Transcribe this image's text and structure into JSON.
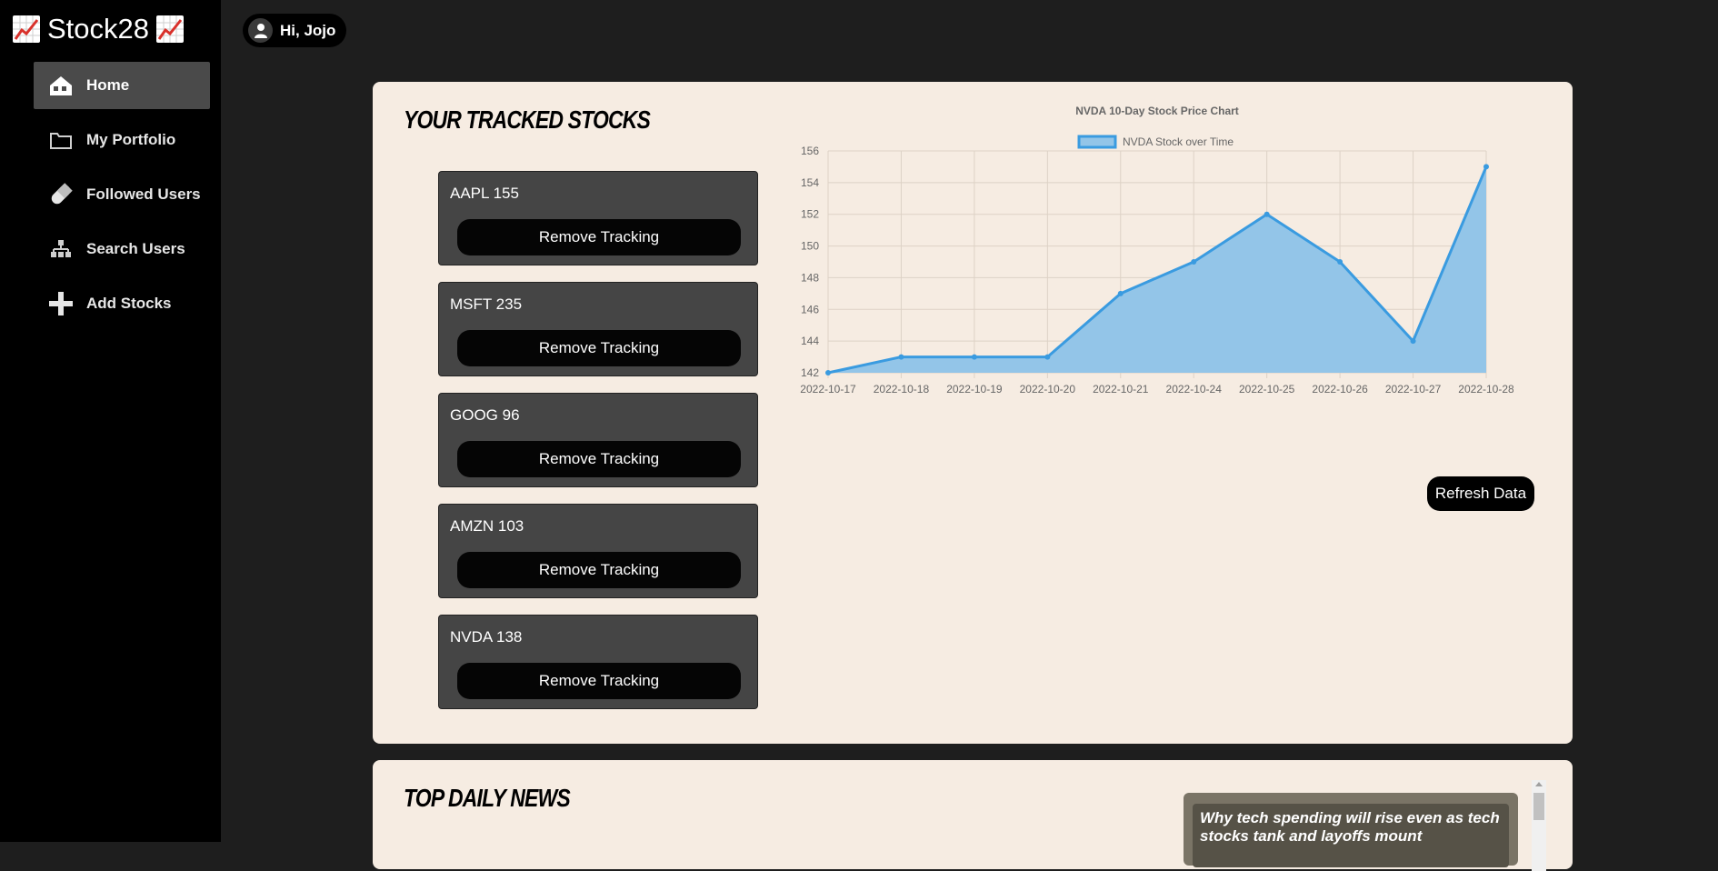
{
  "brand": {
    "name": "Stock28",
    "icon": "chart-increasing-emoji"
  },
  "nav": [
    {
      "label": "Home",
      "icon": "home-icon",
      "active": true
    },
    {
      "label": "My Portfolio",
      "icon": "folder-icon",
      "active": false
    },
    {
      "label": "Followed Users",
      "icon": "pill-icon",
      "active": false
    },
    {
      "label": "Search Users",
      "icon": "network-icon",
      "active": false
    },
    {
      "label": "Add Stocks",
      "icon": "plus-icon",
      "active": false
    }
  ],
  "user": {
    "greeting": "Hi, Jojo",
    "icon": "user-icon"
  },
  "tracked": {
    "title": "Your Tracked Stocks",
    "stocks": [
      {
        "label": "AAPL 155",
        "button": "Remove Tracking"
      },
      {
        "label": "MSFT 235",
        "button": "Remove Tracking"
      },
      {
        "label": "GOOG 96",
        "button": "Remove Tracking"
      },
      {
        "label": "AMZN 103",
        "button": "Remove Tracking"
      },
      {
        "label": "NVDA 138",
        "button": "Remove Tracking"
      }
    ],
    "refresh_label": "Refresh Data"
  },
  "chart_data": {
    "type": "area",
    "title": "NVDA 10-Day Stock Price Chart",
    "series": [
      {
        "name": "NVDA Stock over Time",
        "values": [
          142,
          143,
          143,
          143,
          147,
          149,
          152,
          149,
          144,
          155
        ],
        "color": "#3a9be0",
        "fill": "#93c5e8"
      }
    ],
    "categories": [
      "2022-10-17",
      "2022-10-18",
      "2022-10-19",
      "2022-10-20",
      "2022-10-21",
      "2022-10-24",
      "2022-10-25",
      "2022-10-26",
      "2022-10-27",
      "2022-10-28"
    ],
    "ylim": [
      142,
      156
    ],
    "yticks": [
      142,
      144,
      146,
      148,
      150,
      152,
      154,
      156
    ],
    "grid": true,
    "legend": "top"
  },
  "news": {
    "title": "Top Daily News",
    "items": [
      {
        "headline": "Why tech spending will rise even as tech stocks tank and layoffs mount"
      }
    ]
  },
  "colors": {
    "card_bg": "#f6ece2",
    "sidebar_bg": "#000000",
    "page_bg": "#1e1e1e",
    "stock_card_bg": "#454545"
  }
}
